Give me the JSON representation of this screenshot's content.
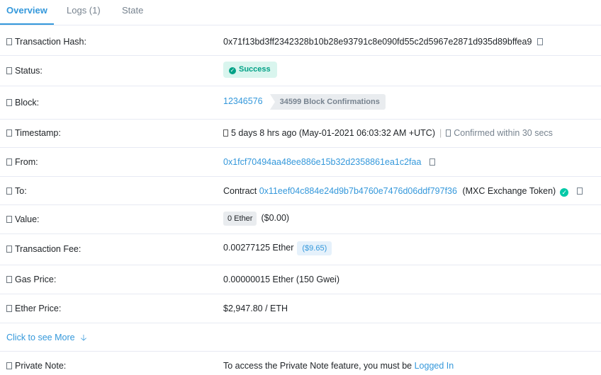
{
  "tabs": [
    {
      "label": "Overview"
    },
    {
      "label": "Logs (1)"
    },
    {
      "label": "State"
    }
  ],
  "rows": {
    "hash": {
      "label": "Transaction Hash:",
      "value": "0x71f13bd3ff2342328b10b28e93791c8e090fd55c2d5967e2871d935d89bffea9"
    },
    "status": {
      "label": "Status:",
      "value": "Success"
    },
    "block": {
      "label": "Block:",
      "value": "12346576",
      "confirmations": "34599 Block Confirmations"
    },
    "timestamp": {
      "label": "Timestamp:",
      "value": "5 days 8 hrs ago (May-01-2021 06:03:32 AM +UTC)",
      "separator": "|",
      "confirmed": "Confirmed within 30 secs"
    },
    "from": {
      "label": "From:",
      "value": "0x1fcf70494aa48ee886e15b32d2358861ea1c2faa"
    },
    "to": {
      "label": "To:",
      "prefix": "Contract",
      "address": "0x11eef04c884e24d9b7b4760e7476d06ddf797f36",
      "token": "(MXC Exchange Token)"
    },
    "value": {
      "label": "Value:",
      "amount": "0 Ether",
      "usd": "($0.00)"
    },
    "fee": {
      "label": "Transaction Fee:",
      "amount": "0.00277125 Ether",
      "usd": "($9.65)"
    },
    "gas": {
      "label": "Gas Price:",
      "value": "0.00000015 Ether (150 Gwei)"
    },
    "ether_price": {
      "label": "Ether Price:",
      "value": "$2,947.80 / ETH"
    },
    "note": {
      "label": "Private Note:",
      "text": "To access the Private Note feature, you must be",
      "link": "Logged In"
    }
  },
  "more": {
    "label": "Click to see More",
    "icon": "arrow-down-icon"
  },
  "colors": {
    "accent": "#3498db",
    "success": "#00a186",
    "border": "#e7eaf3"
  }
}
